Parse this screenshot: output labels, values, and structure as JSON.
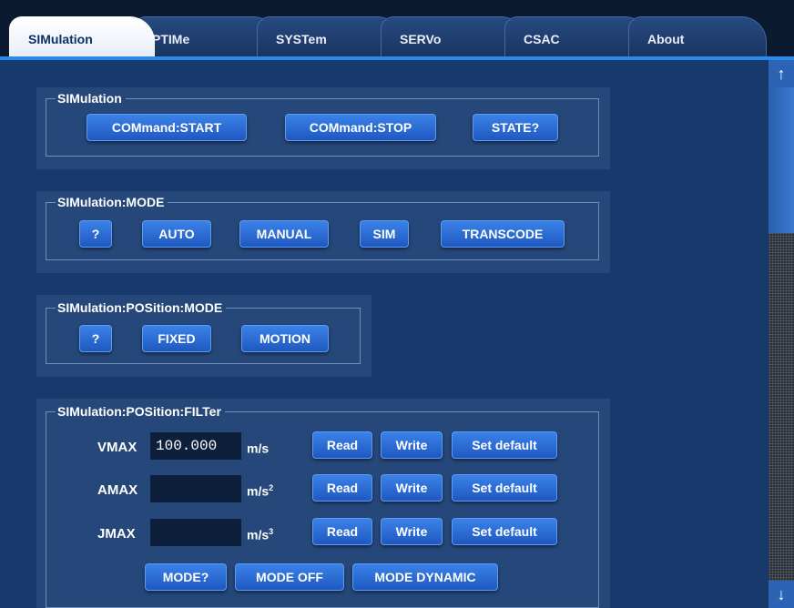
{
  "tabs": [
    {
      "label": "SIMulation",
      "active": true
    },
    {
      "label": "PTIMe",
      "active": false
    },
    {
      "label": "SYSTem",
      "active": false
    },
    {
      "label": "SERVo",
      "active": false
    },
    {
      "label": "CSAC",
      "active": false
    },
    {
      "label": "About",
      "active": false
    }
  ],
  "sections": {
    "simulation": {
      "title": "SIMulation",
      "buttons": [
        "COMmand:START",
        "COMmand:STOP",
        "STATE?"
      ]
    },
    "mode": {
      "title": "SIMulation:MODE",
      "buttons": [
        "?",
        "AUTO",
        "MANUAL",
        "SIM",
        "TRANSCODE"
      ]
    },
    "position_mode": {
      "title": "SIMulation:POSition:MODE",
      "buttons": [
        "?",
        "FIXED",
        "MOTION"
      ]
    },
    "filter": {
      "title": "SIMulation:POSition:FILTer",
      "rows": [
        {
          "label": "VMAX",
          "value": "100.000",
          "unit": "m/s",
          "unit_sup": ""
        },
        {
          "label": "AMAX",
          "value": "",
          "unit": "m/s",
          "unit_sup": "2"
        },
        {
          "label": "JMAX",
          "value": "",
          "unit": "m/s",
          "unit_sup": "3"
        }
      ],
      "row_buttons": {
        "read": "Read",
        "write": "Write",
        "default": "Set default"
      },
      "mode_buttons": [
        "MODE?",
        "MODE OFF",
        "MODE DYNAMIC"
      ]
    }
  },
  "scrollbar": {
    "up_icon": "↑",
    "down_icon": "↓"
  },
  "colors": {
    "background": "#18396b",
    "panel": "#254779",
    "button": "#2f6fd8",
    "tab_active": "#ffffff",
    "tabbar_accent": "#2b8be8"
  }
}
